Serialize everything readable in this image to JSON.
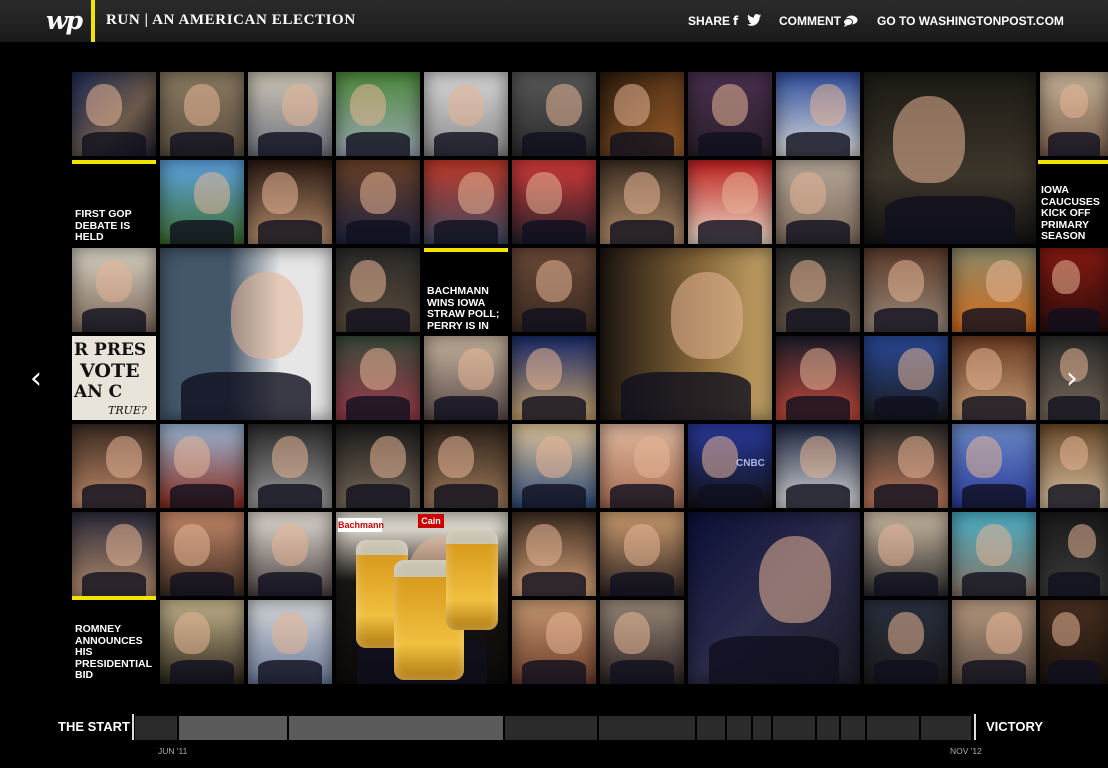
{
  "header": {
    "logo": "wp",
    "title": "RUN | AN AMERICAN ELECTION",
    "share_label": "SHARE",
    "facebook_glyph": "f",
    "comment_label": "COMMENT",
    "goto_label": "GO TO WASHINGTONPOST.COM"
  },
  "icons": {
    "facebook": "facebook-icon",
    "twitter": "twitter-icon",
    "comment": "comment-bubble-icon",
    "prev": "chevron-left-icon",
    "next": "chevron-right-icon"
  },
  "arrows": {
    "prev_glyph": "‹",
    "next_glyph": "›"
  },
  "captions": {
    "debate": "FIRST GOP DEBATE IS HELD",
    "bachmann": "BACHMANN WINS IOWA STRAW POLL; PERRY IS IN",
    "iowa": "IOWA CAUCUSES KICK OFF PRIMARY SEASON",
    "romney": "ROMNEY ANNOUNCES HIS PRESIDENTIAL BID"
  },
  "photo_sign": {
    "line1": "R PRES",
    "line2": "VOTE",
    "line3": "AN C",
    "line4": "TRUE?"
  },
  "photo_cards": {
    "bachmann": "Bachmann",
    "cain": "Cain",
    "cnbc": "CNBC"
  },
  "timeline": {
    "start_label": "THE START",
    "end_label": "VICTORY",
    "start_date": "JUN '11",
    "end_date": "NOV '12"
  },
  "colors": {
    "accent": "#f3e300",
    "background": "#000000",
    "topbar": "#222222"
  }
}
